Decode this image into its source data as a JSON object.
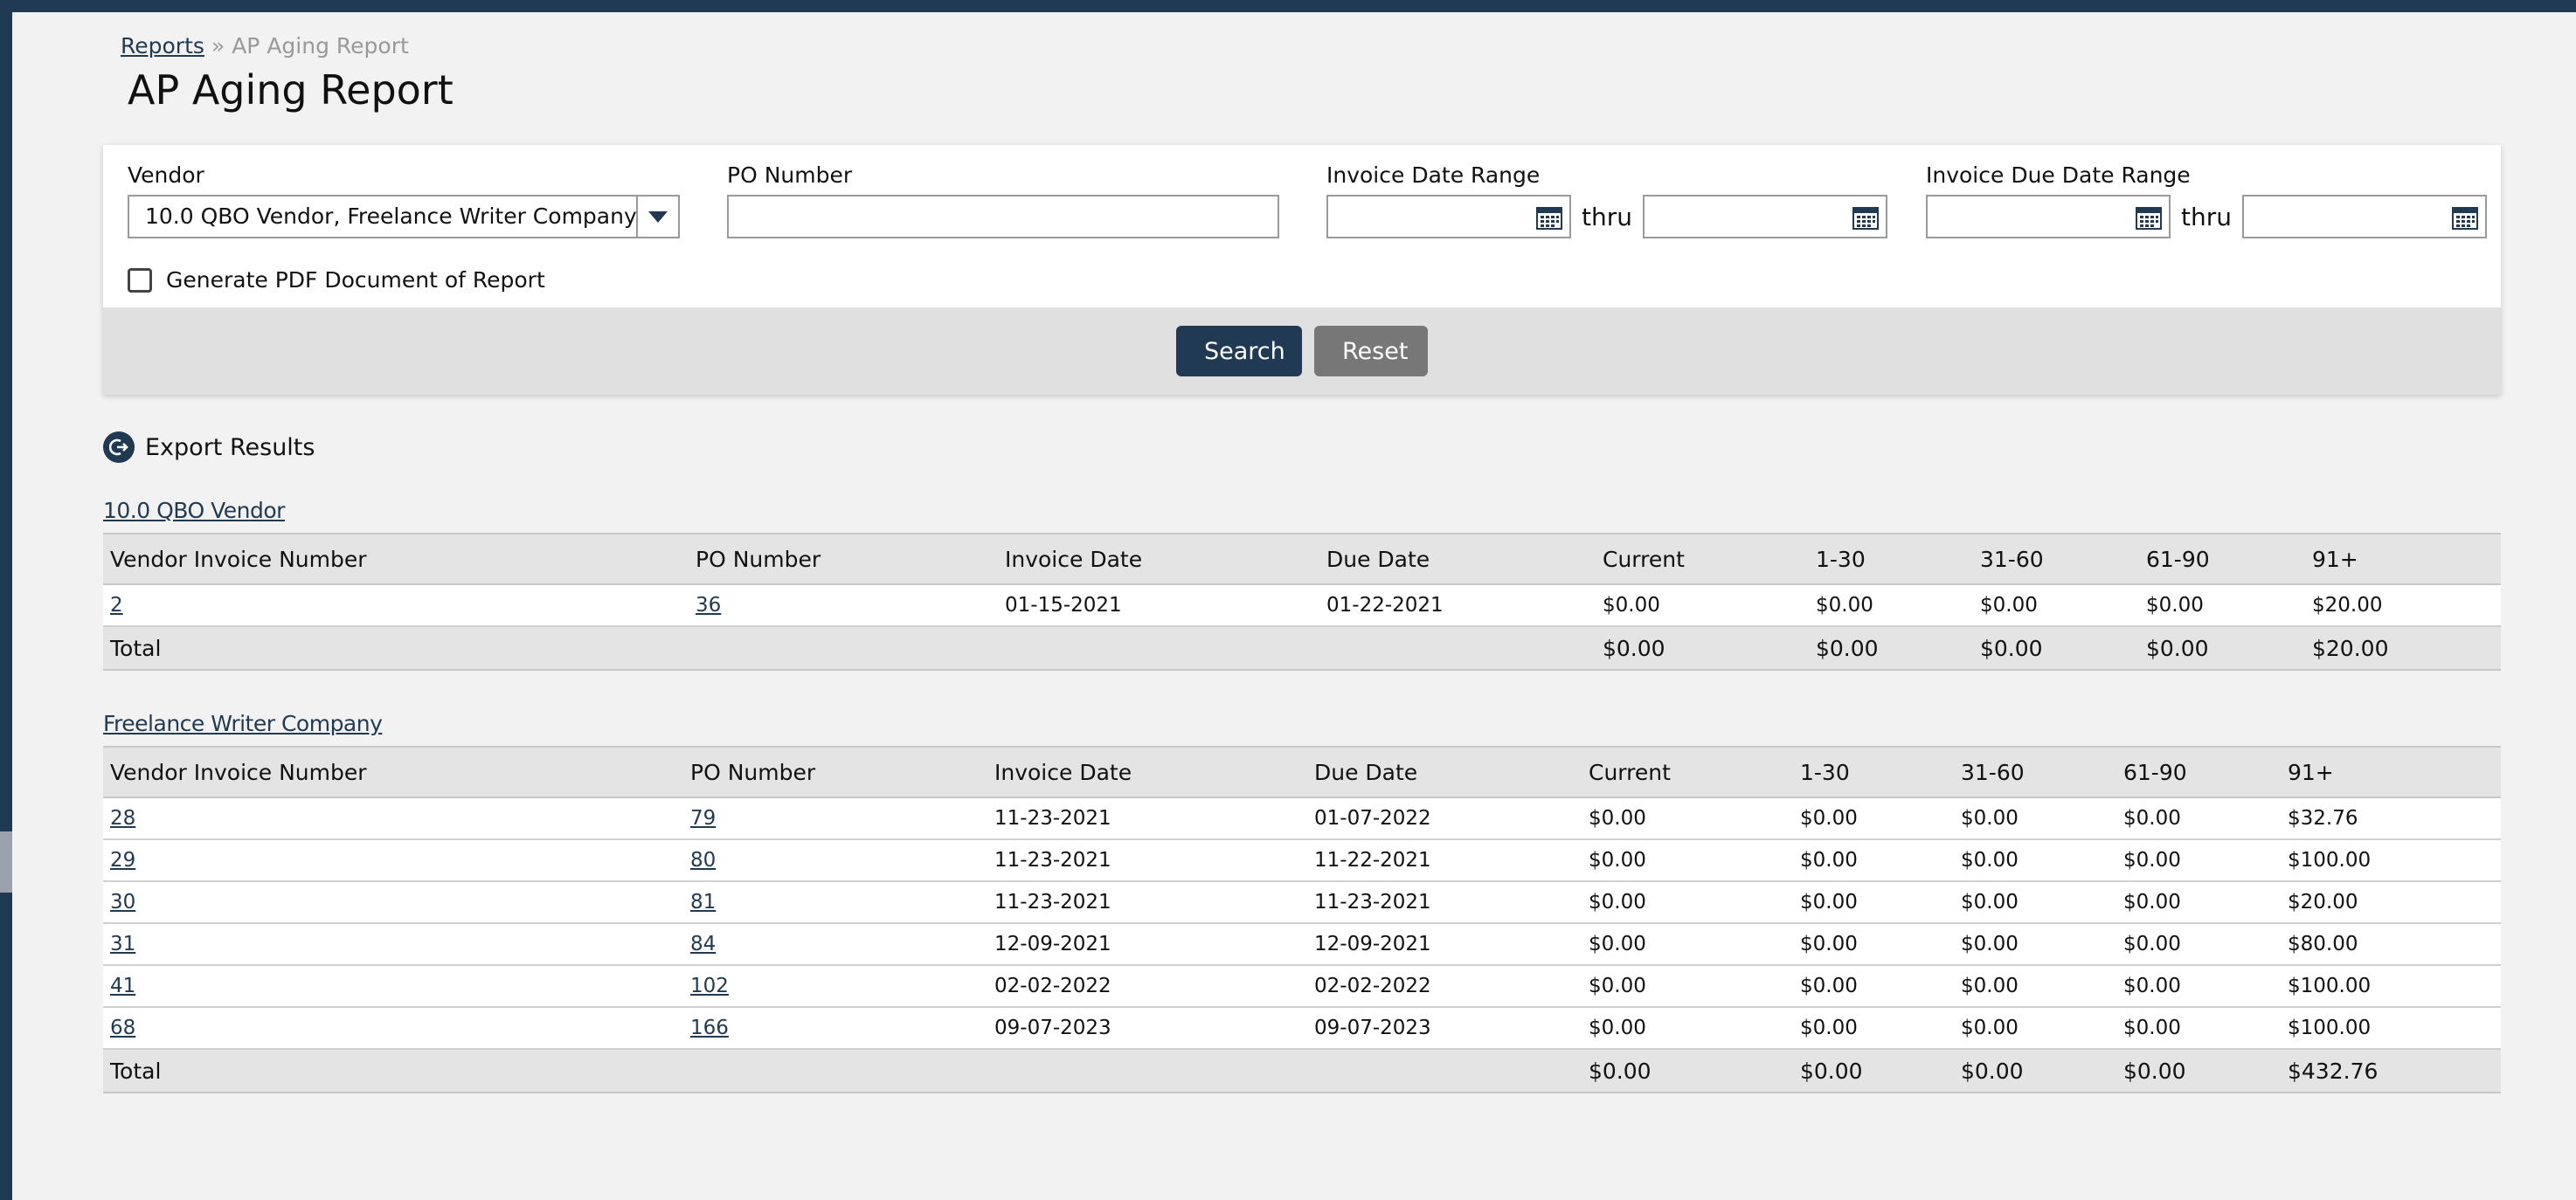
{
  "breadcrumb": {
    "parent": "Reports",
    "separator": "»",
    "current": "AP Aging Report"
  },
  "page_title": "AP Aging Report",
  "filters": {
    "vendor_label": "Vendor",
    "vendor_value": "10.0 QBO Vendor, Freelance Writer Company",
    "po_label": "PO Number",
    "po_value": "",
    "invoice_date_label": "Invoice Date Range",
    "invoice_due_label": "Invoice Due Date Range",
    "thru": "thru",
    "pdf_label": "Generate PDF Document of Report"
  },
  "actions": {
    "search": "Search",
    "reset": "Reset"
  },
  "export_label": "Export Results",
  "columns": [
    "Vendor Invoice Number",
    "PO Number",
    "Invoice Date",
    "Due Date",
    "Current",
    "1-30",
    "31-60",
    "61-90",
    "91+"
  ],
  "vendors": [
    {
      "name": "10.0 QBO Vendor",
      "rows": [
        {
          "inv": "2",
          "po": "36",
          "invoice_date": "01-15-2021",
          "due_date": "01-22-2021",
          "current": "$0.00",
          "d1_30": "$0.00",
          "d31_60": "$0.00",
          "d61_90": "$0.00",
          "d91": "$20.00"
        }
      ],
      "total": {
        "label": "Total",
        "current": "$0.00",
        "d1_30": "$0.00",
        "d31_60": "$0.00",
        "d61_90": "$0.00",
        "d91": "$20.00"
      }
    },
    {
      "name": "Freelance Writer Company",
      "rows": [
        {
          "inv": "28",
          "po": "79",
          "invoice_date": "11-23-2021",
          "due_date": "01-07-2022",
          "current": "$0.00",
          "d1_30": "$0.00",
          "d31_60": "$0.00",
          "d61_90": "$0.00",
          "d91": "$32.76"
        },
        {
          "inv": "29",
          "po": "80",
          "invoice_date": "11-23-2021",
          "due_date": "11-22-2021",
          "current": "$0.00",
          "d1_30": "$0.00",
          "d31_60": "$0.00",
          "d61_90": "$0.00",
          "d91": "$100.00"
        },
        {
          "inv": "30",
          "po": "81",
          "invoice_date": "11-23-2021",
          "due_date": "11-23-2021",
          "current": "$0.00",
          "d1_30": "$0.00",
          "d31_60": "$0.00",
          "d61_90": "$0.00",
          "d91": "$20.00"
        },
        {
          "inv": "31",
          "po": "84",
          "invoice_date": "12-09-2021",
          "due_date": "12-09-2021",
          "current": "$0.00",
          "d1_30": "$0.00",
          "d31_60": "$0.00",
          "d61_90": "$0.00",
          "d91": "$80.00"
        },
        {
          "inv": "41",
          "po": "102",
          "invoice_date": "02-02-2022",
          "due_date": "02-02-2022",
          "current": "$0.00",
          "d1_30": "$0.00",
          "d31_60": "$0.00",
          "d61_90": "$0.00",
          "d91": "$100.00"
        },
        {
          "inv": "68",
          "po": "166",
          "invoice_date": "09-07-2023",
          "due_date": "09-07-2023",
          "current": "$0.00",
          "d1_30": "$0.00",
          "d31_60": "$0.00",
          "d61_90": "$0.00",
          "d91": "$100.00"
        }
      ],
      "total": {
        "label": "Total",
        "current": "$0.00",
        "d1_30": "$0.00",
        "d31_60": "$0.00",
        "d61_90": "$0.00",
        "d91": "$432.76"
      }
    }
  ]
}
